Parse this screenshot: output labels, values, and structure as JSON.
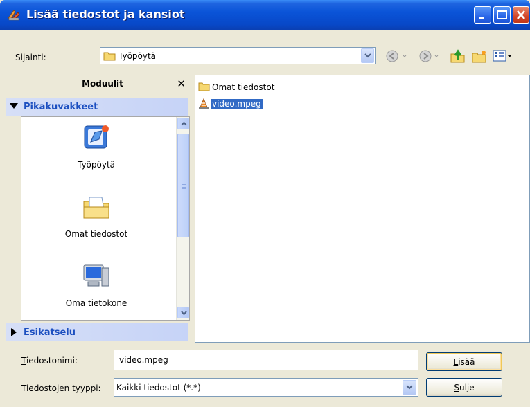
{
  "window": {
    "title": "Lisää tiedostot ja kansiot",
    "controls": [
      "minimize-icon",
      "maximize-icon",
      "close-icon"
    ]
  },
  "location": {
    "label": "Sijainti:",
    "value": "Työpöytä",
    "nav_icons": [
      "back-icon",
      "forward-icon",
      "up-folder-icon",
      "new-folder-icon",
      "view-menu-icon"
    ]
  },
  "modules": {
    "title": "Moduulit",
    "close_glyph": "✕",
    "sections": [
      {
        "label": "Pikakuvakkeet",
        "expanded": true
      },
      {
        "label": "Esikatselu",
        "expanded": false
      }
    ],
    "shortcuts": [
      {
        "label": "Työpöytä",
        "icon": "desktop-icon"
      },
      {
        "label": "Omat tiedostot",
        "icon": "my-documents-icon"
      },
      {
        "label": "Oma tietokone",
        "icon": "my-computer-icon"
      }
    ]
  },
  "files": [
    {
      "name": "Omat tiedostot",
      "icon": "folder-icon",
      "selected": false
    },
    {
      "name": "video.mpeg",
      "icon": "vlc-cone-icon",
      "selected": true
    }
  ],
  "form": {
    "filename_label_u": "T",
    "filename_label_rest": "iedostonimi:",
    "filename_value": "video.mpeg",
    "filetype_label_pre": "Ti",
    "filetype_label_u": "e",
    "filetype_label_rest": "dostojen tyyppi:",
    "filetype_value": "Kaikki tiedostot (*.*)",
    "add_u": "L",
    "add_rest": "isää",
    "close_u": "S",
    "close_rest": "ulje"
  },
  "colors": {
    "titlebar": "#0a54d8",
    "selection": "#316ac5",
    "section_text": "#1c4fc0",
    "window_bg": "#ece9d8"
  }
}
